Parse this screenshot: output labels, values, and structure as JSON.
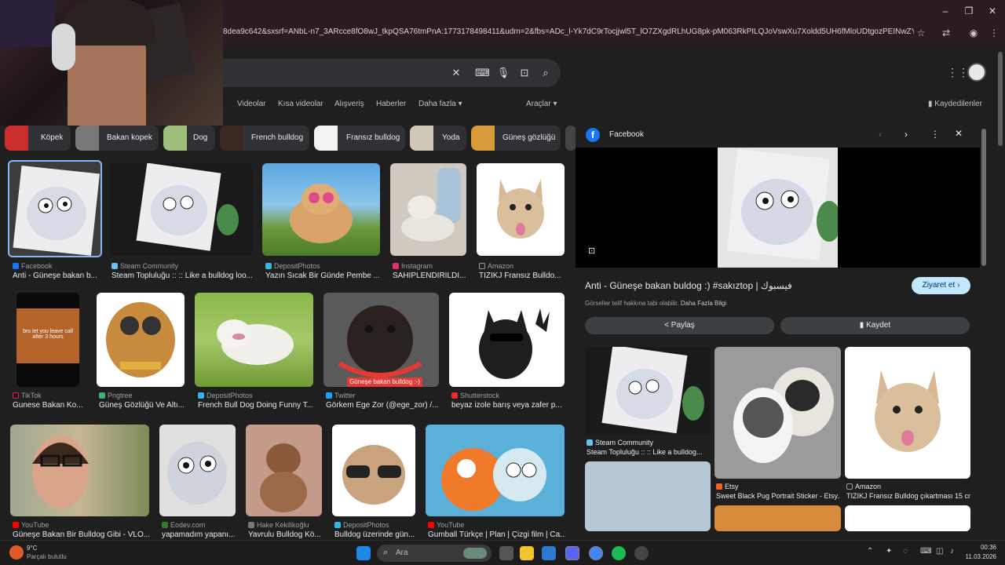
{
  "browser": {
    "url": "8dea9c642&sxsrf=ANbL-n7_3ARcce8fO8wJ_tkpQSA76tmPnA:1773178498411&udm=2&fbs=ADc_l-Yk7dC9rTocjjwl5T_lO7ZXgdRLhUG8pk-pM063RkPILQJoVswXu7Xoldd5UH6fMloUDtgozPEINwZYSjs_WJgHl0H2A...",
    "minimize_icon": "minimize-icon",
    "maximize_icon": "maximize-icon",
    "close_icon": "close-icon"
  },
  "search": {
    "nav_tabs": [
      "Videolar",
      "Kısa videolar",
      "Alışveriş",
      "Haberler",
      "Daha fazla",
      "Araçlar"
    ],
    "saved_label": "Kaydedilenler"
  },
  "chips": [
    "Köpek",
    "Bakan kopek",
    "Dog",
    "French bulldog",
    "Fransız bulldog",
    "Yoda",
    "Güneş gözlüğü"
  ],
  "results": [
    {
      "source": "Facebook",
      "caption": "Anti - Güneşe bakan b..."
    },
    {
      "source": "Steam Community",
      "caption": "Steam Topluluğu :: :: Like a bulldog loo..."
    },
    {
      "source": "DepositPhotos",
      "caption": "Yazın Sıcak Bir Günde Pembe ..."
    },
    {
      "source": "Instagram",
      "caption": "SAHIPLENDIRILDI..."
    },
    {
      "source": "Amazon",
      "caption": "TIZIKJ Fransız Bulldo..."
    },
    {
      "source": "TikTok",
      "caption": "Gunese Bakan Ko..."
    },
    {
      "source": "Pngtree",
      "caption": "Güneş Gözlüğü Ve Altı..."
    },
    {
      "source": "DepositPhotos",
      "caption": "French Bull Dog Doing Funny T..."
    },
    {
      "source": "Twitter",
      "caption": "Görkem Ege Zor (@ege_zor) /..."
    },
    {
      "source": "Shutterstock",
      "caption": "beyaz izole barış veya zafer p..."
    },
    {
      "source": "YouTube",
      "caption": "Güneşe Bakan Bir Bulldog Gibi - VLO..."
    },
    {
      "source": "Eodev.com",
      "caption": "yapamadım yapanı..."
    },
    {
      "source": "Hake Kekilikoğlu",
      "caption": "Yavrulu Bulldog Kö..."
    },
    {
      "source": "DepositPhotos",
      "caption": "Bulldog üzerinde gün..."
    },
    {
      "source": "YouTube",
      "caption": "Gumball Türkçe | Plan | Çizgi film | Ca..."
    }
  ],
  "tile_overlays": {
    "tiktok_text": "bro let you leave call after 3 hours",
    "twitter_text": "Güneşe bakan bulldog :-)"
  },
  "panel": {
    "source": "Facebook",
    "title": "Anti - Güneşe bakan buldog :) #sakıztop | فيسبوك",
    "visit_label": "Ziyaret et",
    "copyright": "Görseller telif hakkına tabi olabilir.",
    "more_info": "Daha Fazla Bilgi",
    "share_label": "Paylaş",
    "save_label": "Kaydet",
    "related": [
      {
        "source": "Steam Community",
        "caption": "Steam Topluluğu :: :: Like a bulldog..."
      },
      {
        "source": "Etsy",
        "caption": "Sweet Black Pug Portrait Sticker - Etsy..."
      },
      {
        "source": "Amazon",
        "caption": "TIZIKJ Fransız Bulldog çıkartması 15 cm..."
      }
    ]
  },
  "taskbar": {
    "search_placeholder": "Ara",
    "time": "00:36",
    "date": "11.03.2026",
    "weather_temp": "9°C",
    "weather_desc": "Parçalı bulutlu"
  },
  "colors": {
    "background": "#1f1f1f",
    "accent_blue": "#8ab4f8",
    "visit_button": "#c2e7ff",
    "panel_button": "#3c4043"
  }
}
